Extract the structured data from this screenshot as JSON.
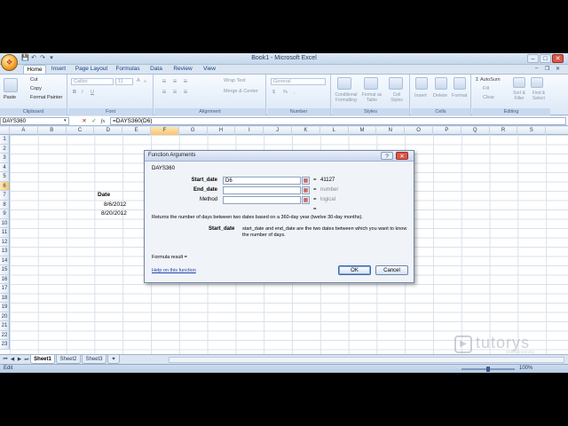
{
  "window": {
    "title": "Book1 - Microsoft Excel",
    "minimize": "–",
    "maximize": "□",
    "close": "✕",
    "doc_minimize": "–",
    "doc_restore": "❐",
    "doc_close": "✕"
  },
  "qat": {
    "save": "💾",
    "undo": "↶",
    "redo": "↷",
    "more": "▾"
  },
  "tabs": [
    "Home",
    "Insert",
    "Page Layout",
    "Formulas",
    "Data",
    "Review",
    "View"
  ],
  "ribbon": {
    "clipboard": {
      "label": "Clipboard",
      "paste": "Paste",
      "cut": "Cut",
      "copy": "Copy",
      "format_painter": "Format Painter"
    },
    "font": {
      "label": "Font",
      "font_name": "Calibri",
      "font_size": "11",
      "bold": "B",
      "italic": "I",
      "underline": "U",
      "grow": "A",
      "shrink": "A"
    },
    "alignment": {
      "label": "Alignment",
      "wrap_text": "Wrap Text",
      "merge_center": "Merge & Center"
    },
    "number": {
      "label": "Number",
      "format": "General",
      "currency": "$",
      "percent": "%",
      "comma": ","
    },
    "styles": {
      "label": "Styles",
      "conditional": "Conditional Formatting",
      "format_table": "Format as Table",
      "cell_styles": "Cell Styles"
    },
    "cells": {
      "label": "Cells",
      "insert": "Insert",
      "delete": "Delete",
      "format": "Format"
    },
    "editing": {
      "label": "Editing",
      "autosum": "AutoSum",
      "fill": "Fill",
      "clear": "Clear",
      "sort": "Sort & Filter",
      "find": "Find & Select"
    }
  },
  "formula_bar": {
    "name_box": "DAYS360",
    "cancel": "✕",
    "enter": "✓",
    "fx": "fx",
    "formula": "=DAYS360(D6)"
  },
  "columns": [
    "A",
    "B",
    "C",
    "D",
    "E",
    "F",
    "G",
    "H",
    "I",
    "J",
    "K",
    "L",
    "M",
    "N",
    "O",
    "P",
    "Q",
    "R",
    "S"
  ],
  "rows": [
    "1",
    "2",
    "3",
    "4",
    "5",
    "6",
    "7",
    "8",
    "9",
    "10",
    "11",
    "12",
    "13",
    "14",
    "15",
    "16",
    "17",
    "18",
    "19",
    "20",
    "21",
    "22",
    "23"
  ],
  "cells": {
    "d5": "Date",
    "d6": "8/6/2012",
    "d7": "8/20/2012"
  },
  "dialog": {
    "title": "Function Arguments",
    "help_icon": "?",
    "close": "✕",
    "function_name": "DAYS360",
    "args": [
      {
        "label": "Start_date",
        "value": "D6",
        "result": "41127"
      },
      {
        "label": "End_date",
        "value": "",
        "result": "number"
      },
      {
        "label": "Method",
        "value": "",
        "result": "logical"
      }
    ],
    "equals": "=",
    "description": "Returns the number of days between two dates based on a 360-day year (twelve 30-day months).",
    "arg_name": "Start_date",
    "arg_description": "start_date and end_date are the two dates between which you want to know the number of days.",
    "formula_result": "Formula result =",
    "help_link": "Help on this function",
    "ok": "OK",
    "cancel": "Cancel"
  },
  "sheets": {
    "nav": [
      "⏮",
      "◀",
      "▶",
      "⏭"
    ],
    "tabs": [
      "Sheet1",
      "Sheet2",
      "Sheet3"
    ]
  },
  "status": {
    "mode": "Edit",
    "zoom": "100%"
  },
  "watermark": {
    "brand": "tutorys",
    "tagline": "Online Learning"
  }
}
